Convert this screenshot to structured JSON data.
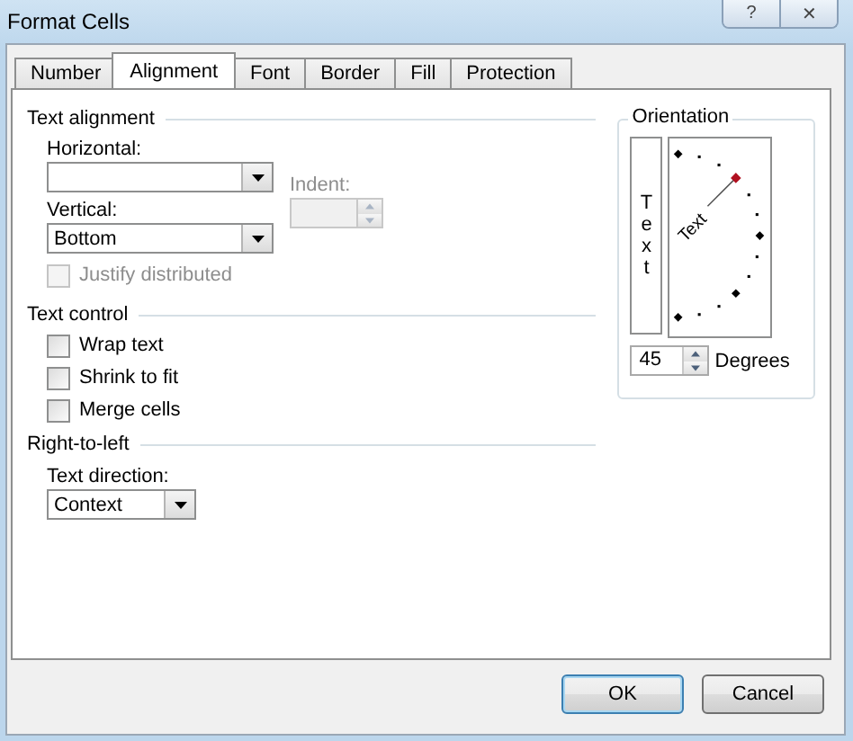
{
  "window": {
    "title": "Format Cells",
    "help": "?",
    "close": "✕"
  },
  "tabs": [
    {
      "label": "Number",
      "selected": false
    },
    {
      "label": "Alignment",
      "selected": true
    },
    {
      "label": "Font",
      "selected": false
    },
    {
      "label": "Border",
      "selected": false
    },
    {
      "label": "Fill",
      "selected": false
    },
    {
      "label": "Protection",
      "selected": false
    }
  ],
  "text_alignment": {
    "title": "Text alignment",
    "horizontal": {
      "label": "Horizontal:"
    },
    "indent": {
      "label": "Indent:",
      "disabled": true
    },
    "vertical": {
      "label": "Vertical:",
      "value": "Bottom"
    },
    "justify_distributed": {
      "label": "Justify distributed",
      "checked": false,
      "disabled": true
    }
  },
  "text_control": {
    "title": "Text control",
    "options": [
      {
        "label": "Wrap text",
        "checked": false
      },
      {
        "label": "Shrink to fit",
        "checked": false
      },
      {
        "label": "Merge cells",
        "checked": false
      }
    ]
  },
  "right_to_left": {
    "title": "Right-to-left",
    "text_direction": {
      "label": "Text direction:",
      "value": "Context"
    }
  },
  "orientation": {
    "title": "Orientation",
    "vertical_text": "Text",
    "dial_text": "Text",
    "degrees": {
      "value": "45",
      "label": "Degrees"
    }
  },
  "buttons": [
    {
      "label": "OK",
      "default": true
    },
    {
      "label": "Cancel",
      "default": false
    }
  ]
}
